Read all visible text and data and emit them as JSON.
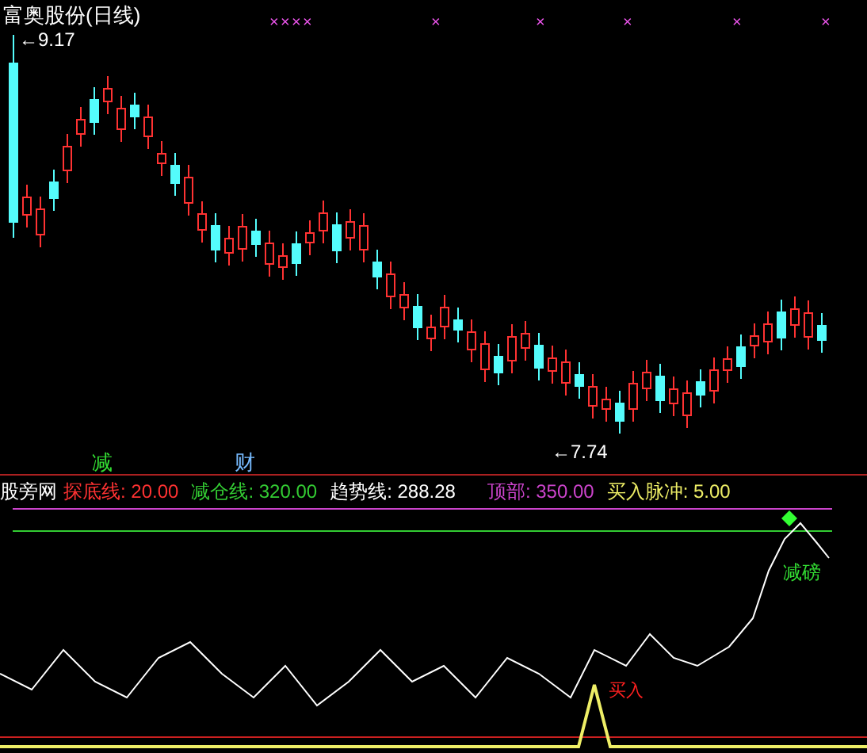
{
  "title": "富奥股份(日线)",
  "price_chart": {
    "high_label": "←9.17",
    "low_label": "←7.74",
    "signals": [
      {
        "text": "减",
        "color": "#33dd33"
      },
      {
        "text": "财",
        "color": "#77bbff"
      }
    ],
    "marks": [
      "×",
      "×",
      "×",
      "×",
      "×",
      "×",
      "×",
      "×",
      "×"
    ]
  },
  "indicator": {
    "name": "股旁网",
    "values": [
      {
        "label": "探底线: 20.00",
        "color": "#ff3232"
      },
      {
        "label": "减仓线: 320.00",
        "color": "#33cc33"
      },
      {
        "label": "趋势线: 288.28",
        "color": "#ffffff"
      },
      {
        "label": "顶部: 350.00",
        "color": "#cc44cc"
      },
      {
        "label": "买入脉冲: 5.00",
        "color": "#eeee66"
      }
    ],
    "annotations": [
      {
        "text": "买入",
        "color": "#ff2020"
      },
      {
        "text": "减磅",
        "color": "#33dd33"
      }
    ]
  }
}
